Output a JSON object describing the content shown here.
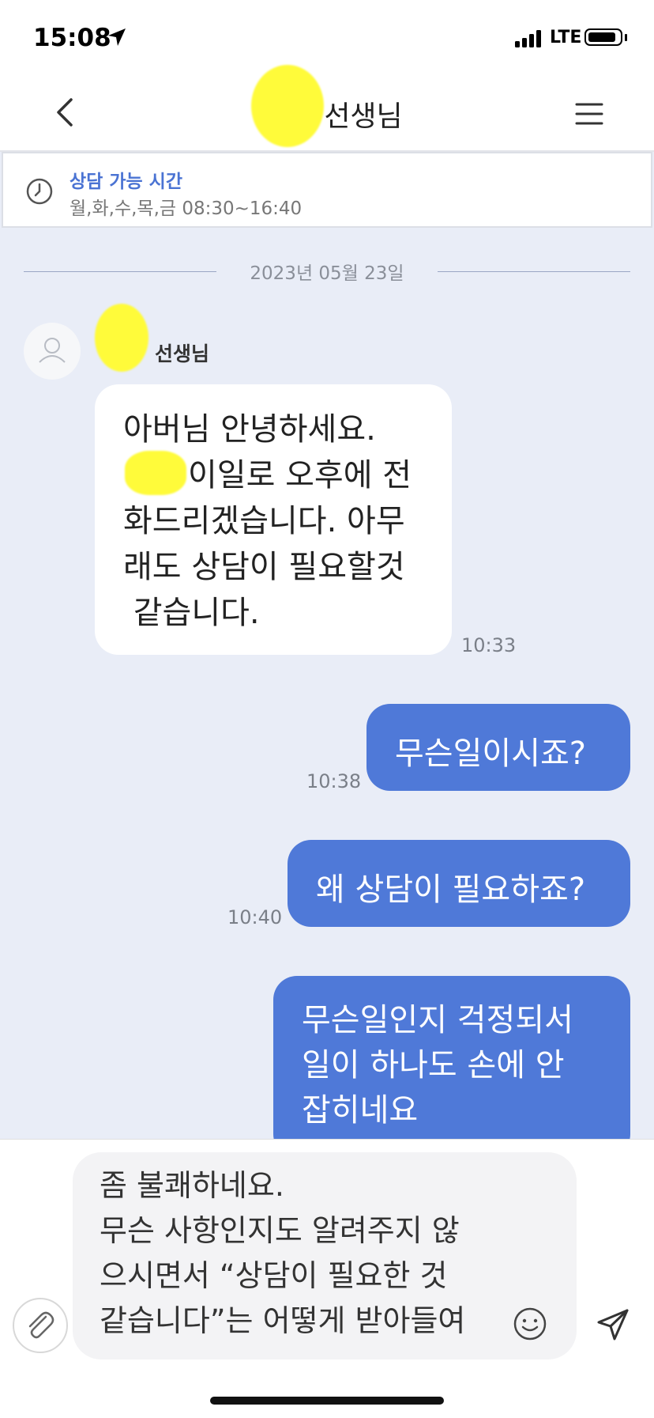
{
  "status_bar": {
    "time": "15:08",
    "network": "LTE",
    "location_icon": "location-arrow-icon",
    "signal_icon": "cellular-signal-icon",
    "battery_icon": "battery-icon"
  },
  "header": {
    "title": "선생님",
    "back_icon": "chevron-left-icon",
    "menu_icon": "hamburger-menu-icon"
  },
  "notice": {
    "icon": "clock-icon",
    "title": "상담 가능 시간",
    "hours": "월,화,수,목,금 08:30~16:40"
  },
  "chat": {
    "date": "2023년 05월 23일",
    "sender": {
      "name": "선생님",
      "avatar_icon": "user-avatar-icon"
    },
    "messages": [
      {
        "direction": "incoming",
        "lines": [
          "아버님 안녕하세요.",
          "이일로 오후에 전",
          "화드리겠습니다. 아무",
          "래도 상담이 필요할것",
          " 같습니다."
        ],
        "time": "10:33"
      },
      {
        "direction": "outgoing",
        "text": "무슨일이시죠?",
        "time": "10:38"
      },
      {
        "direction": "outgoing",
        "text": "왜 상담이 필요하죠?",
        "time": "10:40"
      },
      {
        "direction": "outgoing",
        "lines": [
          "무슨일인지 걱정되서",
          "일이 하나도 손에 안",
          "잡히네요"
        ]
      }
    ]
  },
  "composer": {
    "lines": [
      "좀 불쾌하네요.",
      "무슨 사항인지도 알려주지 않",
      "으시면서 “상담이 필요한 것",
      "같습니다”는 어떻게 받아들여"
    ],
    "attach_icon": "paperclip-icon",
    "emoji_icon": "smiley-icon",
    "send_icon": "send-icon"
  },
  "colors": {
    "accent": "#4f79d8",
    "chat_background": "#e9edf7",
    "notice_title": "#4a73d3"
  }
}
